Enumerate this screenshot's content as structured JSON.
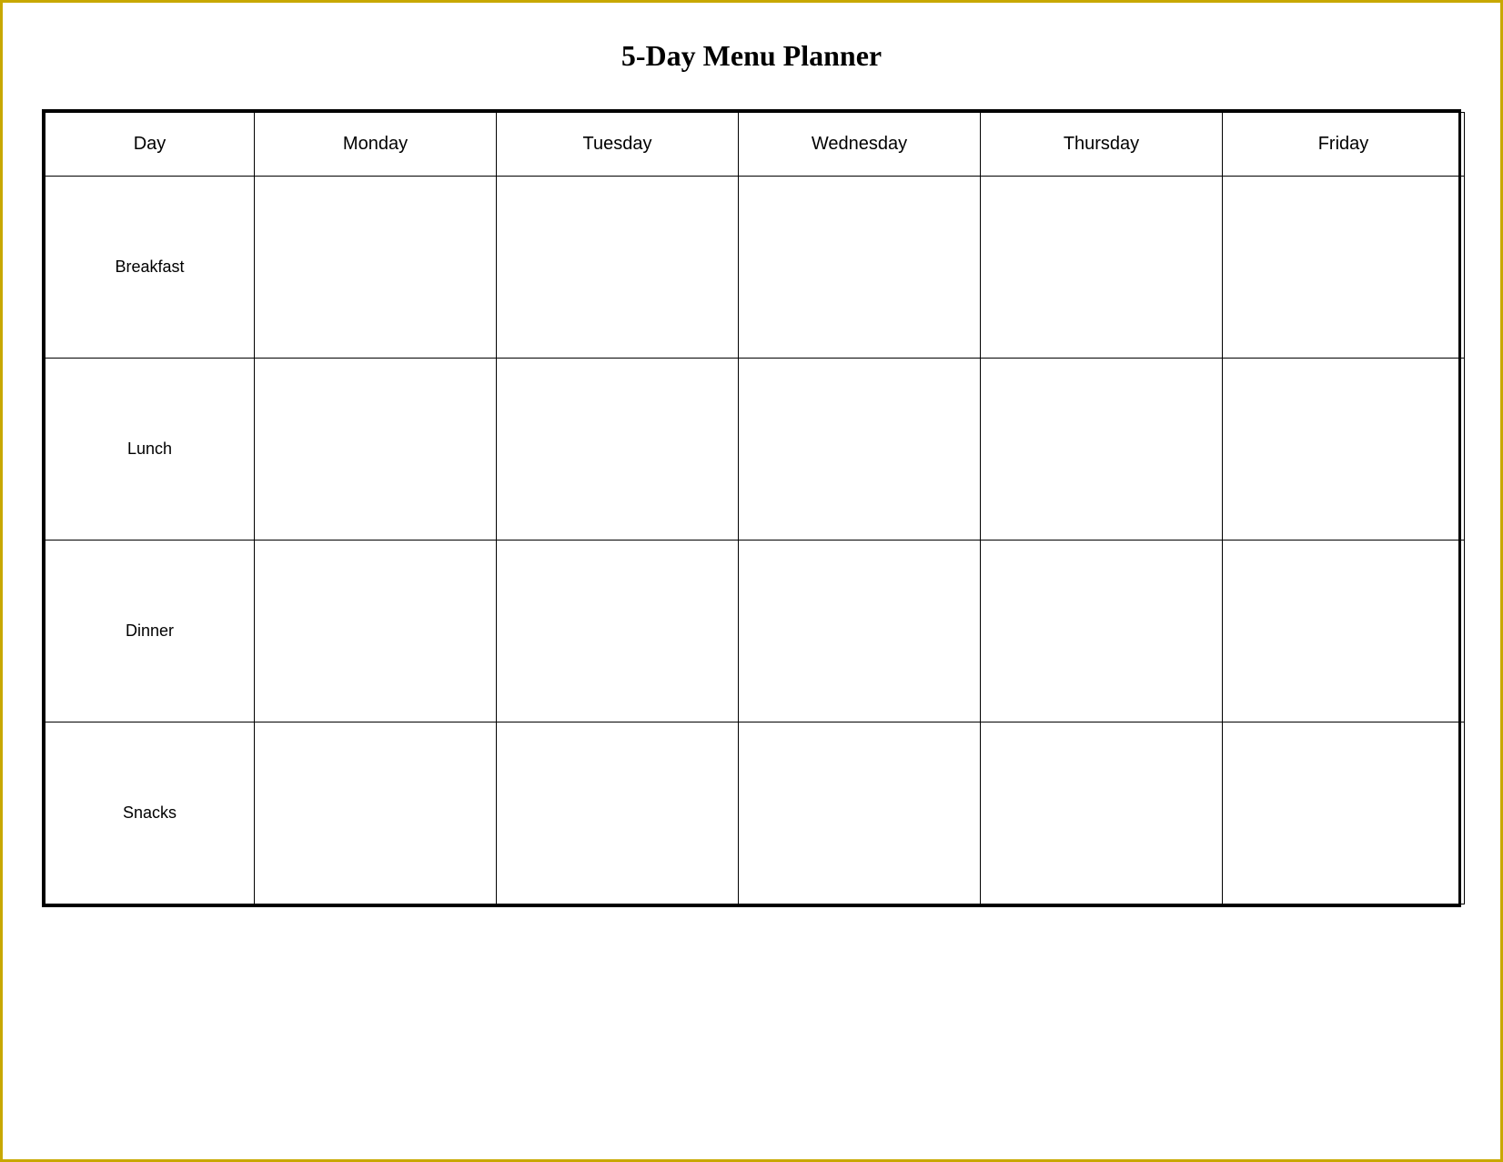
{
  "title": "5-Day Menu Planner",
  "header": {
    "columns": [
      "Day",
      "Monday",
      "Tuesday",
      "Wednesday",
      "Thursday",
      "Friday"
    ]
  },
  "rows": [
    {
      "label": "Breakfast"
    },
    {
      "label": "Lunch"
    },
    {
      "label": "Dinner"
    },
    {
      "label": "Snacks"
    }
  ]
}
